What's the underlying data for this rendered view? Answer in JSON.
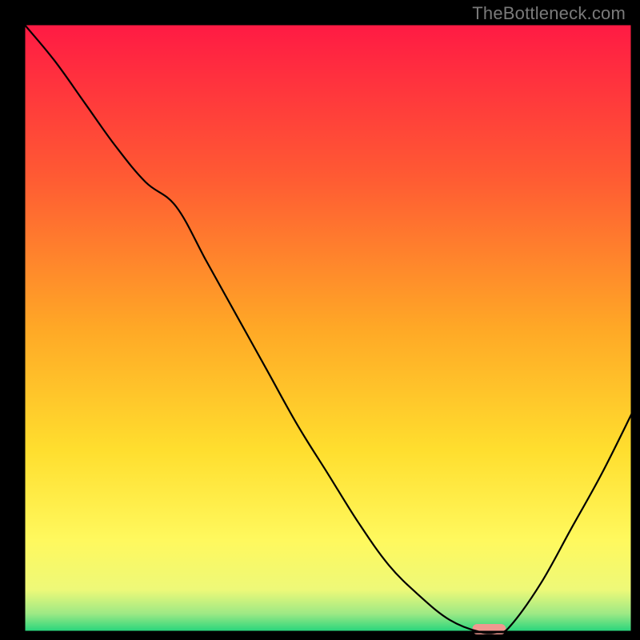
{
  "attribution": "TheBottleneck.com",
  "chart_data": {
    "type": "line",
    "title": "",
    "xlabel": "",
    "ylabel": "",
    "x": [
      0.0,
      0.05,
      0.1,
      0.15,
      0.2,
      0.25,
      0.3,
      0.35,
      0.4,
      0.45,
      0.5,
      0.55,
      0.6,
      0.65,
      0.7,
      0.75,
      0.78,
      0.8,
      0.85,
      0.9,
      0.95,
      1.0
    ],
    "values": [
      1.0,
      0.94,
      0.87,
      0.8,
      0.74,
      0.7,
      0.61,
      0.52,
      0.43,
      0.34,
      0.26,
      0.18,
      0.11,
      0.06,
      0.02,
      0.0,
      0.0,
      0.01,
      0.08,
      0.17,
      0.26,
      0.36
    ],
    "xlim": [
      0,
      1
    ],
    "ylim": [
      0,
      1
    ],
    "marker": {
      "x": 0.765,
      "width": 0.055,
      "color": "#f09890"
    },
    "gradient_background": {
      "stops": [
        {
          "offset": 0.0,
          "color": "#ff1a44"
        },
        {
          "offset": 0.25,
          "color": "#ff5a33"
        },
        {
          "offset": 0.5,
          "color": "#ffa826"
        },
        {
          "offset": 0.7,
          "color": "#ffde2e"
        },
        {
          "offset": 0.85,
          "color": "#fff95e"
        },
        {
          "offset": 0.93,
          "color": "#eef978"
        },
        {
          "offset": 0.97,
          "color": "#9de985"
        },
        {
          "offset": 1.0,
          "color": "#22d47c"
        }
      ]
    }
  }
}
